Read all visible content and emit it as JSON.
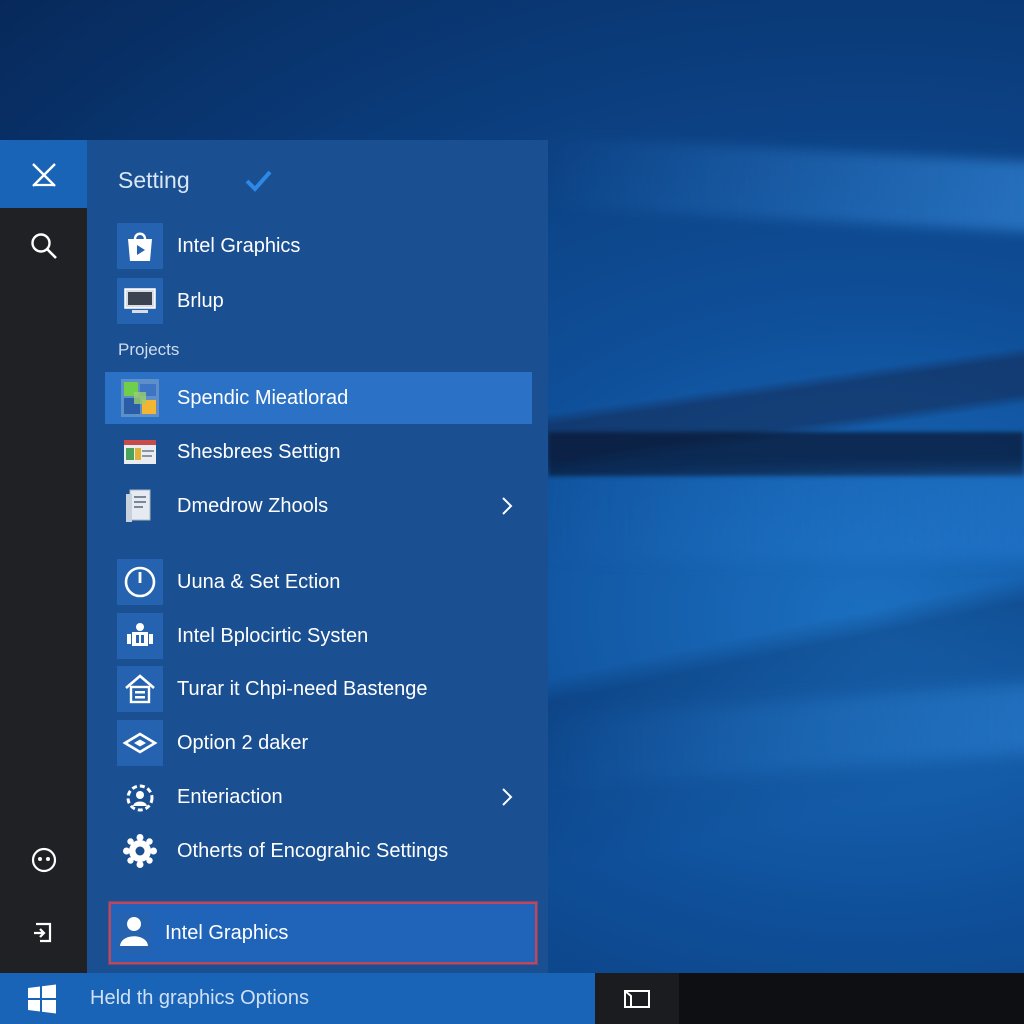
{
  "start_menu": {
    "title": "Setting",
    "sections": {
      "projects_label": "Projects"
    },
    "items": [
      {
        "label": "Intel Graphics",
        "icon": "store-bag-icon"
      },
      {
        "label": "Brlup",
        "icon": "monitor-icon"
      },
      {
        "label": "Spendic Mieatlorad",
        "icon": "photo-app-icon",
        "selected": true
      },
      {
        "label": "Shesbrees Settign",
        "icon": "color-palette-icon"
      },
      {
        "label": "Dmedrow Zhools",
        "icon": "document-tool-icon",
        "has_submenu": true
      },
      {
        "label": "Uuna & Set Ection",
        "icon": "power-clock-icon"
      },
      {
        "label": "Intel Bplocirtic Systen",
        "icon": "system-chip-icon"
      },
      {
        "label": "Turar it Chpi-need Bastenge",
        "icon": "home-lock-icon"
      },
      {
        "label": "Option 2 daker",
        "icon": "diamond-icon"
      },
      {
        "label": "Enteriaction",
        "icon": "gear-person-icon",
        "has_submenu": true
      },
      {
        "label": "Otherts of Encograhic Settings",
        "icon": "settings-gear-icon"
      }
    ],
    "bottom_item": {
      "label": "Intel Graphics",
      "icon": "user-icon"
    }
  },
  "rail": {
    "close_icon": "close-icon",
    "search_icon": "search-icon",
    "feedback_icon": "smiley-icon",
    "power_icon": "power-icon"
  },
  "taskbar": {
    "search_placeholder": "Held th graphics Options",
    "start_icon": "windows-logo-icon",
    "task_view_icon": "task-view-icon"
  },
  "colors": {
    "accent": "#1a64b8",
    "panel": "#1a4f91",
    "selected": "#2b72c6",
    "highlight_border": "#c0475b"
  }
}
